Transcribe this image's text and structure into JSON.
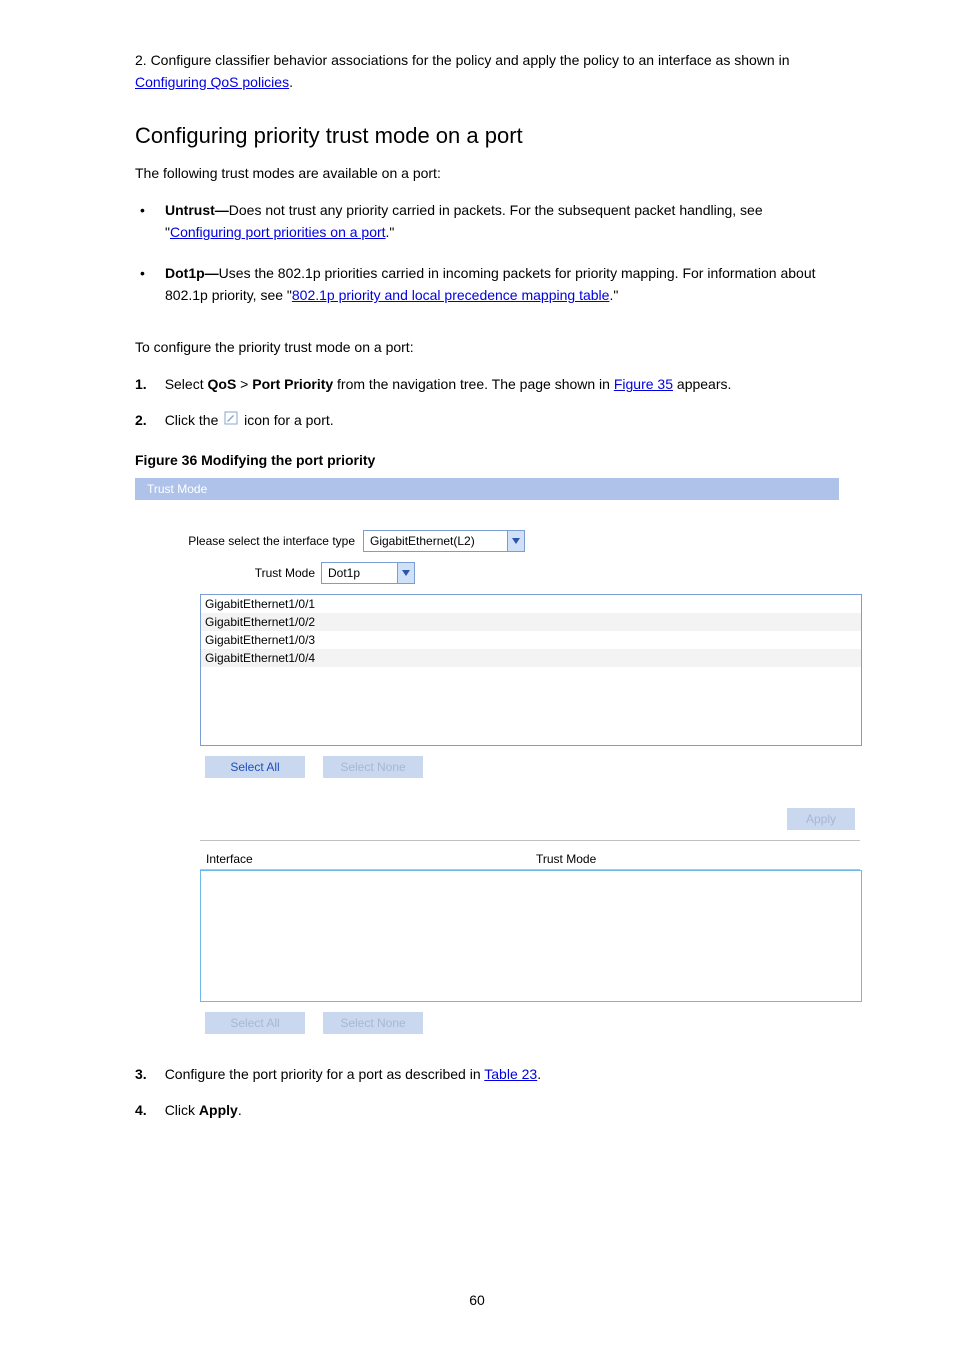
{
  "intro": {
    "p1_prefix": "2. Configure classifier behavior associations for the policy and apply the policy to an interface as",
    "p1_suffix": "shown in ",
    "p1_link": "Configuring QoS policies",
    "p1_tail": "."
  },
  "section_title": "Configuring priority trust mode on a port",
  "section_p": "The following trust modes are available on a port:",
  "bullets": [
    {
      "lead": "Untrust—",
      "text": "Does not trust any priority carried in packets. For the subsequent packet handling, see \"",
      "link": "Configuring port priorities on a port",
      "tail": ".\""
    },
    {
      "lead": "Dot1p—",
      "text": "Uses the 802.1p priorities carried in incoming packets for priority mapping. For information about 802.1p priority, see \"",
      "link": "802.1p priority and local precedence mapping table",
      "tail": ".\""
    }
  ],
  "procedure_lead": "To configure the priority trust mode on a port:",
  "step1": {
    "num": "1.",
    "a": "Select ",
    "b": "QoS",
    "c": " > ",
    "d": "Port Priority",
    "e": " from the navigation tree. The page shown in ",
    "link": "Figure 35",
    "g": " appears."
  },
  "step2": {
    "num": "2.",
    "a": "Click the ",
    "icon_label": "",
    "b": " icon for a port."
  },
  "figure_label": "Figure 36 Modifying the port priority",
  "panel": {
    "title": "Trust Mode",
    "select_type_label": "Please select the interface type",
    "select_type_value": "GigabitEthernet(L2)",
    "trust_mode_label": "Trust Mode",
    "trust_mode_value": "Dot1p",
    "ports": [
      "GigabitEthernet1/0/1",
      "GigabitEthernet1/0/2",
      "GigabitEthernet1/0/3",
      "GigabitEthernet1/0/4"
    ],
    "btn_select_all": "Select All",
    "btn_select_none": "Select None",
    "btn_apply": "Apply",
    "tbl_h1": "Interface",
    "tbl_h2": "Trust Mode"
  },
  "step3": {
    "num": "3.",
    "a": "Configure the port priority for a port as described in ",
    "link": "Table 23",
    "b": "."
  },
  "step4": {
    "num": "4.",
    "lead": "Click ",
    "btn": "Apply",
    "tail": "."
  },
  "page_num": "60"
}
